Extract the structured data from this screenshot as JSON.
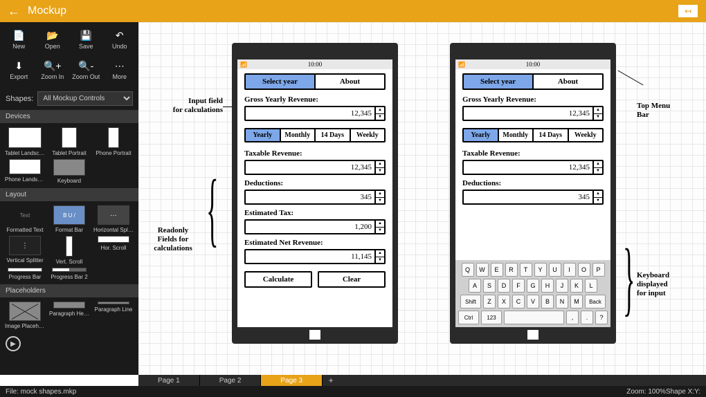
{
  "header": {
    "title": "Mockup"
  },
  "toolbar": [
    {
      "icon": "📄",
      "label": "New"
    },
    {
      "icon": "📂",
      "label": "Open"
    },
    {
      "icon": "💾",
      "label": "Save"
    },
    {
      "icon": "↶",
      "label": "Undo"
    },
    {
      "icon": "⬇",
      "label": "Export"
    },
    {
      "icon": "🔍+",
      "label": "Zoom In"
    },
    {
      "icon": "🔍-",
      "label": "Zoom Out"
    },
    {
      "icon": "⋯",
      "label": "More"
    }
  ],
  "shapes": {
    "label": "Shapes:",
    "selected": "All Mockup Controls"
  },
  "sections": {
    "devices": {
      "title": "Devices",
      "items": [
        "Tablet Landscape",
        "Tablet Portrait",
        "Phone Portrait",
        "Phone Landscape",
        "Keyboard"
      ]
    },
    "layout": {
      "title": "Layout",
      "items": [
        "Formatted Text",
        "Format Bar",
        "Horizontal Splitter",
        "Vertical Splitter",
        "Vert. Scroll",
        "Hor. Scroll",
        "Progress Bar",
        "Progress Bar 2"
      ]
    },
    "placeholders": {
      "title": "Placeholders",
      "items": [
        "Image Placeholder",
        "Paragraph Header",
        "Paragraph Line"
      ]
    }
  },
  "mockup": {
    "time": "10:00",
    "tabs": {
      "select_year": "Select year",
      "about": "About"
    },
    "labels": {
      "gross": "Gross Yearly Revenue:",
      "taxable": "Taxable Revenue:",
      "deductions": "Deductions:",
      "estimated_tax": "Estimated Tax:",
      "net": "Estimated Net Revenue:"
    },
    "values": {
      "gross": "12,345",
      "taxable": "12,345",
      "deductions": "345",
      "tax": "1,200",
      "net": "11,145"
    },
    "periods": [
      "Yearly",
      "Monthly",
      "14 Days",
      "Weekly"
    ],
    "buttons": {
      "calc": "Calculate",
      "clear": "Clear"
    },
    "keyboard": {
      "r1": [
        "Q",
        "W",
        "E",
        "R",
        "T",
        "Y",
        "U",
        "I",
        "O",
        "P"
      ],
      "r2": [
        "A",
        "S",
        "D",
        "F",
        "G",
        "H",
        "J",
        "K",
        "L"
      ],
      "r3": [
        "Shift",
        "Z",
        "X",
        "C",
        "V",
        "B",
        "N",
        "M",
        "Back"
      ],
      "r4": [
        "Ctrl",
        "123",
        "",
        ",",
        ".",
        "?"
      ]
    }
  },
  "annotations": {
    "input_field": "Input field\nfor calculations",
    "readonly": "Readonly\nFields for\ncalculations",
    "top_menu": "Top Menu\nBar",
    "keyboard": "Keyboard\ndisplayed\nfor input"
  },
  "pages": {
    "tabs": [
      "Page 1",
      "Page 2",
      "Page 3"
    ],
    "active": 2
  },
  "status": {
    "file": "File: mock shapes.mkp",
    "zoom": "Zoom: 100%",
    "shapex": "Shape X:",
    "y": "Y:"
  }
}
